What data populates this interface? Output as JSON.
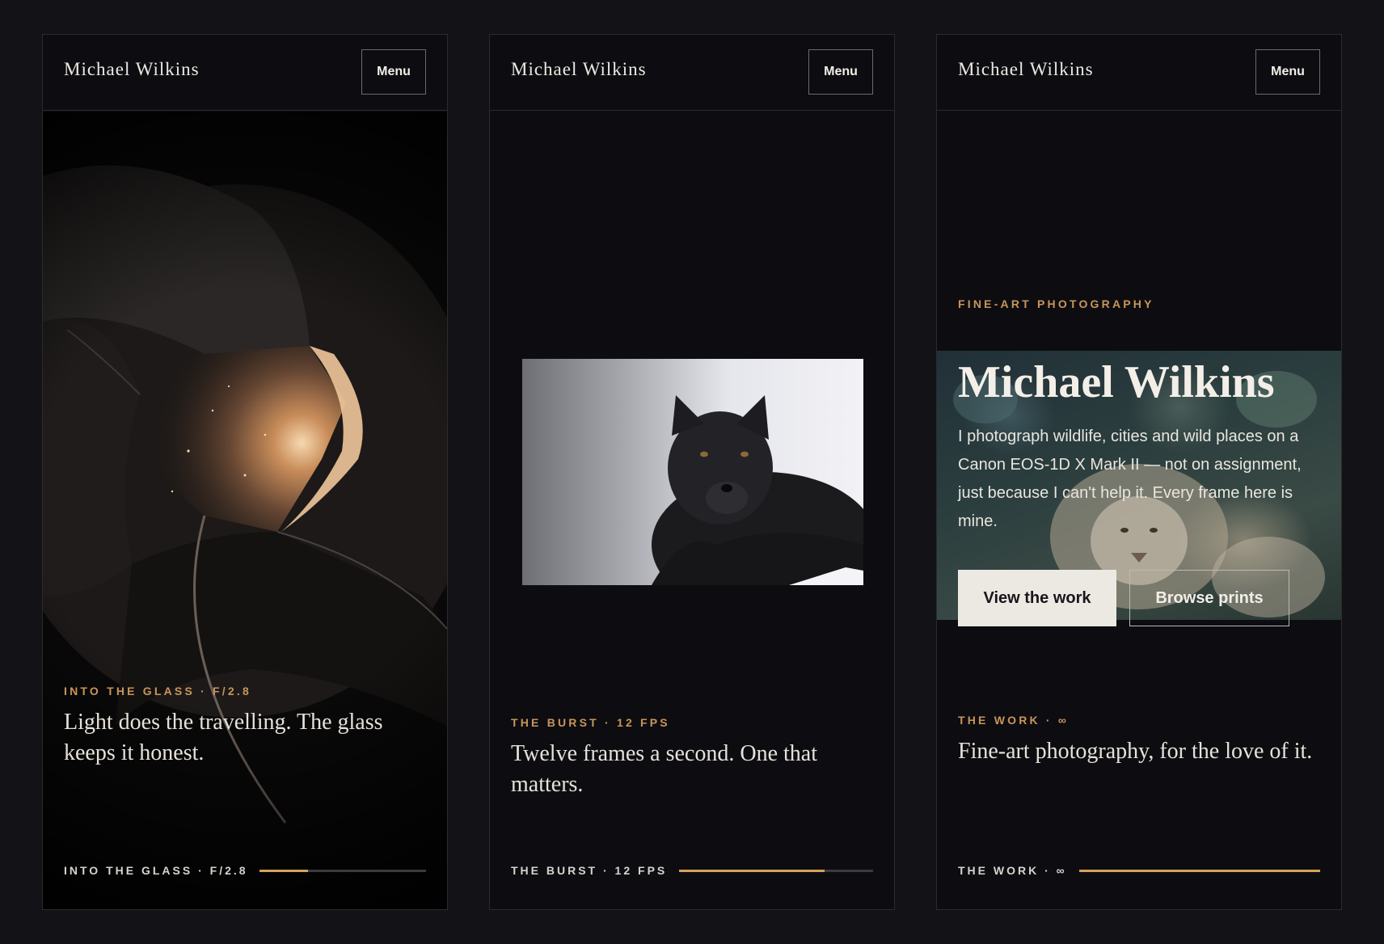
{
  "panels": [
    {
      "brand": "Michael Wilkins",
      "menu_label": "Menu",
      "kicker": "INTO THE GLASS · F/2.8",
      "quote": "Light does the travelling. The glass keeps it honest.",
      "footer_label": "INTO THE GLASS · F/2.8",
      "progress": 0.29
    },
    {
      "brand": "Michael Wilkins",
      "menu_label": "Menu",
      "kicker": "THE BURST · 12 FPS",
      "quote": "Twelve frames a second. One that matters.",
      "footer_label": "THE BURST · 12 FPS",
      "progress": 0.75
    },
    {
      "brand": "Michael Wilkins",
      "menu_label": "Menu",
      "hero": {
        "eyebrow": "FINE-ART PHOTOGRAPHY",
        "title": "Michael Wilkins",
        "lede": "I photograph wildlife, cities and wild places on a Canon EOS-1D X Mark II — not on assignment, just because I can't help it. Every frame here is mine.",
        "primary_button": "View the work",
        "secondary_button": "Browse prints"
      },
      "kicker": "THE WORK · ∞",
      "quote": "Fine-art photography, for the love of it.",
      "footer_label": "THE WORK · ∞",
      "progress": 1.0
    }
  ],
  "colors": {
    "background": "#131216",
    "panel": "#0d0d11",
    "accent_gold": "#c9955a",
    "progress_fill": "#d6a25d",
    "text": "#ece8e2"
  }
}
